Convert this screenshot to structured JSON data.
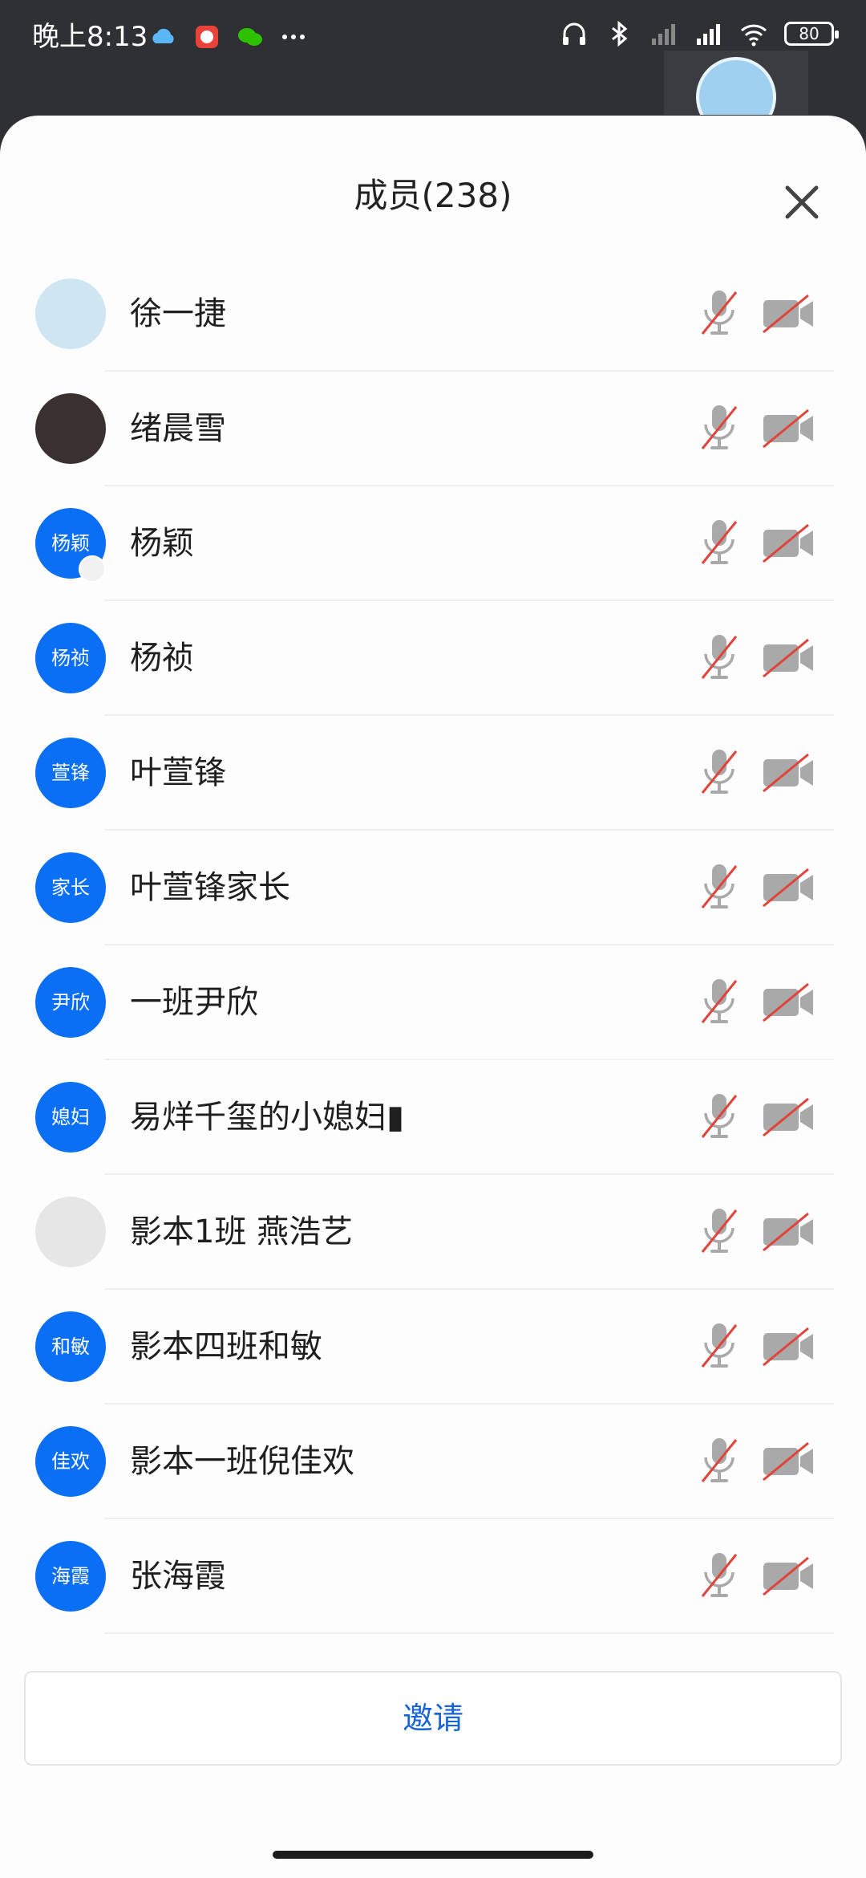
{
  "status_bar": {
    "time": "晚上8:13",
    "left_icons": [
      "cloud-icon",
      "app-badge-icon",
      "wechat-icon",
      "more-dots-icon"
    ],
    "right_icons": [
      "headphones-icon",
      "bluetooth-icon",
      "signal-weak-icon",
      "signal-hd-icon",
      "wifi-icon"
    ],
    "battery": "80"
  },
  "sheet": {
    "title": "成员(238)",
    "close_icon": "close-icon"
  },
  "members": [
    {
      "name": "徐一捷",
      "avatar_text": "",
      "avatar_type": "photo",
      "mic": "muted",
      "camera": "off"
    },
    {
      "name": "绪晨雪",
      "avatar_text": "",
      "avatar_type": "photo",
      "mic": "muted",
      "camera": "off"
    },
    {
      "name": "杨颖",
      "avatar_text": "杨颖",
      "avatar_type": "text",
      "mic": "muted",
      "camera": "off"
    },
    {
      "name": "杨祯",
      "avatar_text": "杨祯",
      "avatar_type": "text",
      "mic": "muted",
      "camera": "off"
    },
    {
      "name": "叶萱锋",
      "avatar_text": "萱锋",
      "avatar_type": "text",
      "mic": "muted",
      "camera": "off"
    },
    {
      "name": "叶萱锋家长",
      "avatar_text": "家长",
      "avatar_type": "text",
      "mic": "muted",
      "camera": "off"
    },
    {
      "name": "一班尹欣",
      "avatar_text": "尹欣",
      "avatar_type": "text",
      "mic": "muted",
      "camera": "off"
    },
    {
      "name": "易烊千玺的小媳妇▮",
      "avatar_text": "媳妇",
      "avatar_type": "text",
      "mic": "muted",
      "camera": "off"
    },
    {
      "name": "影本1班 燕浩艺",
      "avatar_text": "",
      "avatar_type": "photo",
      "mic": "muted",
      "camera": "off"
    },
    {
      "name": "影本四班和敏",
      "avatar_text": "和敏",
      "avatar_type": "text",
      "mic": "muted",
      "camera": "off"
    },
    {
      "name": "影本一班倪佳欢",
      "avatar_text": "佳欢",
      "avatar_type": "text",
      "mic": "muted",
      "camera": "off"
    },
    {
      "name": "张海霞",
      "avatar_text": "海霞",
      "avatar_type": "text",
      "mic": "muted",
      "camera": "off"
    }
  ],
  "invite_label": "邀请",
  "colors": {
    "avatar_blue": "#0b6ff5",
    "mute_red": "#e0443a",
    "icon_gray": "#a9a9a9",
    "invite_text": "#1763d8"
  }
}
